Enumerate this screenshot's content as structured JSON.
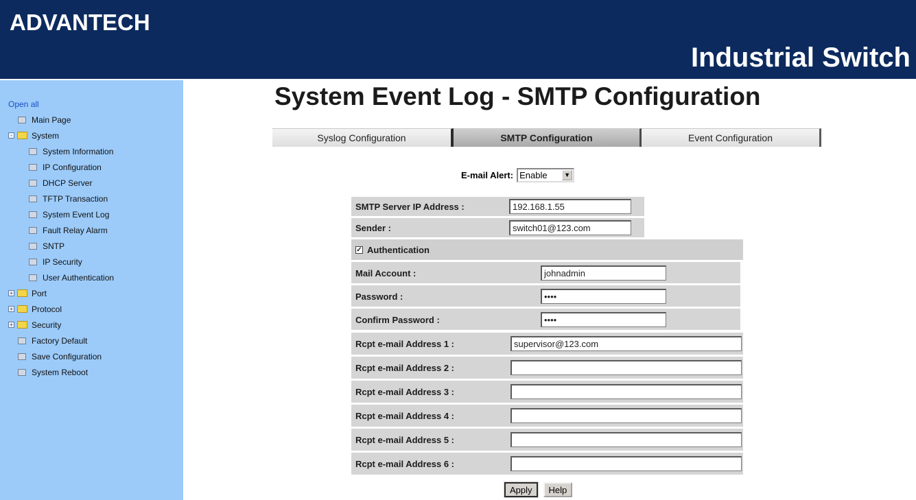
{
  "header": {
    "logo": "ADVANTECH",
    "product": "Industrial Switch"
  },
  "sidebar": {
    "open_all": "Open all",
    "items": [
      {
        "label": "Main Page",
        "level": 1,
        "kind": "doc"
      },
      {
        "label": "System",
        "level": 0,
        "kind": "folder",
        "expander": "-"
      },
      {
        "label": "System Information",
        "level": 2,
        "kind": "doc"
      },
      {
        "label": "IP Configuration",
        "level": 2,
        "kind": "doc"
      },
      {
        "label": "DHCP Server",
        "level": 2,
        "kind": "doc"
      },
      {
        "label": "TFTP Transaction",
        "level": 2,
        "kind": "doc"
      },
      {
        "label": "System Event Log",
        "level": 2,
        "kind": "doc"
      },
      {
        "label": "Fault Relay Alarm",
        "level": 2,
        "kind": "doc"
      },
      {
        "label": "SNTP",
        "level": 2,
        "kind": "doc"
      },
      {
        "label": "IP Security",
        "level": 2,
        "kind": "doc"
      },
      {
        "label": "User Authentication",
        "level": 2,
        "kind": "doc"
      },
      {
        "label": "Port",
        "level": 0,
        "kind": "folder",
        "expander": "+"
      },
      {
        "label": "Protocol",
        "level": 0,
        "kind": "folder",
        "expander": "+"
      },
      {
        "label": "Security",
        "level": 0,
        "kind": "folder",
        "expander": "+"
      },
      {
        "label": "Factory Default",
        "level": 1,
        "kind": "doc"
      },
      {
        "label": "Save Configuration",
        "level": 1,
        "kind": "doc"
      },
      {
        "label": "System Reboot",
        "level": 1,
        "kind": "doc"
      }
    ]
  },
  "page": {
    "title": "System Event Log - SMTP Configuration"
  },
  "tabs": [
    {
      "label": "Syslog Configuration",
      "active": false
    },
    {
      "label": "SMTP Configuration",
      "active": true
    },
    {
      "label": "Event Configuration",
      "active": false
    }
  ],
  "email_alert": {
    "label": "E-mail Alert:",
    "value": "Enable"
  },
  "form": {
    "smtp_server": {
      "label": "SMTP Server IP Address :",
      "value": "192.168.1.55"
    },
    "sender": {
      "label": "Sender :",
      "value": "switch01@123.com"
    },
    "authentication": {
      "label": "Authentication",
      "checked": true
    },
    "mail_account": {
      "label": "Mail Account :",
      "value": "johnadmin"
    },
    "password": {
      "label": "Password :",
      "value": "••••"
    },
    "confirm_password": {
      "label": "Confirm Password :",
      "value": "••••"
    },
    "recipients": [
      {
        "label": "Rcpt e-mail Address 1 :",
        "value": "supervisor@123.com"
      },
      {
        "label": "Rcpt e-mail Address 2 :",
        "value": ""
      },
      {
        "label": "Rcpt e-mail Address 3 :",
        "value": ""
      },
      {
        "label": "Rcpt e-mail Address 4 :",
        "value": ""
      },
      {
        "label": "Rcpt e-mail Address 5 :",
        "value": ""
      },
      {
        "label": "Rcpt e-mail Address 6 :",
        "value": ""
      }
    ]
  },
  "buttons": {
    "apply": "Apply",
    "help": "Help"
  },
  "colors": {
    "header_bg": "#0c2a5e",
    "sidebar_bg": "#9ccbfa",
    "form_bg": "#d5d5d5"
  }
}
